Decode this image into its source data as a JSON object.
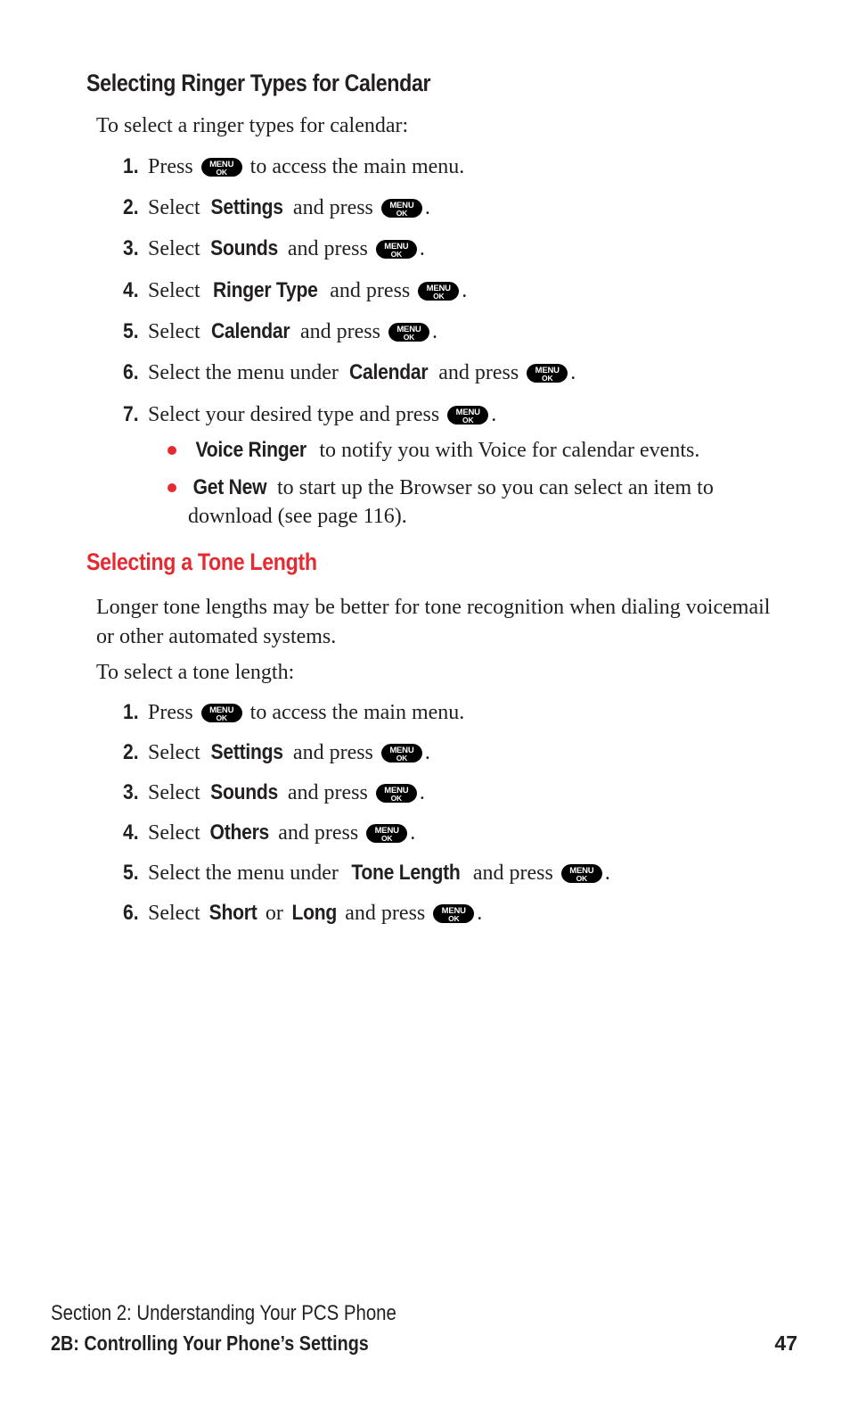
{
  "page": {
    "number": "47",
    "accent_red": "#e32b31",
    "text_color": "#231f20",
    "background": "#ffffff"
  },
  "key_icon": {
    "line1": "MENU",
    "line2": "OK",
    "name": "menu-ok-key-icon"
  },
  "sections": [
    {
      "heading": "Selecting Ringer Types for Calendar",
      "heading_color": "#231f20",
      "intro": "To select a ringer types for calendar:",
      "steps": [
        {
          "num": "1.",
          "pre": "Press ",
          "bold": "",
          "mid": "",
          "post": " to access the main menu."
        },
        {
          "num": "2.",
          "pre": "Select ",
          "bold": "Settings",
          "mid": " and press ",
          "post": "."
        },
        {
          "num": "3.",
          "pre": "Select ",
          "bold": "Sounds",
          "mid": " and press ",
          "post": "."
        },
        {
          "num": "4.",
          "pre": "Select ",
          "bold": "Ringer Type",
          "mid": " and press ",
          "post": "."
        },
        {
          "num": "5.",
          "pre": "Select ",
          "bold": "Calendar",
          "mid": " and press ",
          "post": "."
        },
        {
          "num": "6.",
          "pre": "Select the menu under ",
          "bold": "Calendar",
          "mid": " and press ",
          "post": "."
        },
        {
          "num": "7.",
          "pre": "Select your desired type and press ",
          "bold": "",
          "mid": "",
          "post": "."
        }
      ],
      "bullets": [
        {
          "bold": "Voice Ringer",
          "rest": " to notify you with Voice for calendar events."
        },
        {
          "bold": "Get New",
          "rest": " to start up the Browser so you can select an item to download (see page 116)."
        }
      ]
    },
    {
      "heading": "Selecting a Tone Length",
      "heading_color": "#e32b31",
      "paragraph": "Longer tone lengths may be better for tone recognition when dialing voicemail or other automated systems.",
      "intro": "To select a tone length:",
      "steps": [
        {
          "num": "1.",
          "pre": "Press ",
          "bold": "",
          "mid": "",
          "post": " to access the main menu."
        },
        {
          "num": "2.",
          "pre": "Select ",
          "bold": "Settings",
          "mid": " and press ",
          "post": "."
        },
        {
          "num": "3.",
          "pre": "Select ",
          "bold": "Sounds",
          "mid": " and press ",
          "post": "."
        },
        {
          "num": "4.",
          "pre": "Select ",
          "bold": "Others",
          "mid": " and press ",
          "post": "."
        },
        {
          "num": "5.",
          "pre": "Select the menu under ",
          "bold": "Tone Length",
          "mid": " and press ",
          "post": "."
        },
        {
          "num": "6.",
          "pre": "Select ",
          "bold": "Short",
          "mid": " or ",
          "bold2": "Long",
          "mid2": " and press ",
          "post": "."
        }
      ]
    }
  ],
  "footer": {
    "line1": "Section 2: Understanding Your PCS Phone",
    "line2": "2B: Controlling Your Phone’s Settings",
    "page_number": "47"
  }
}
